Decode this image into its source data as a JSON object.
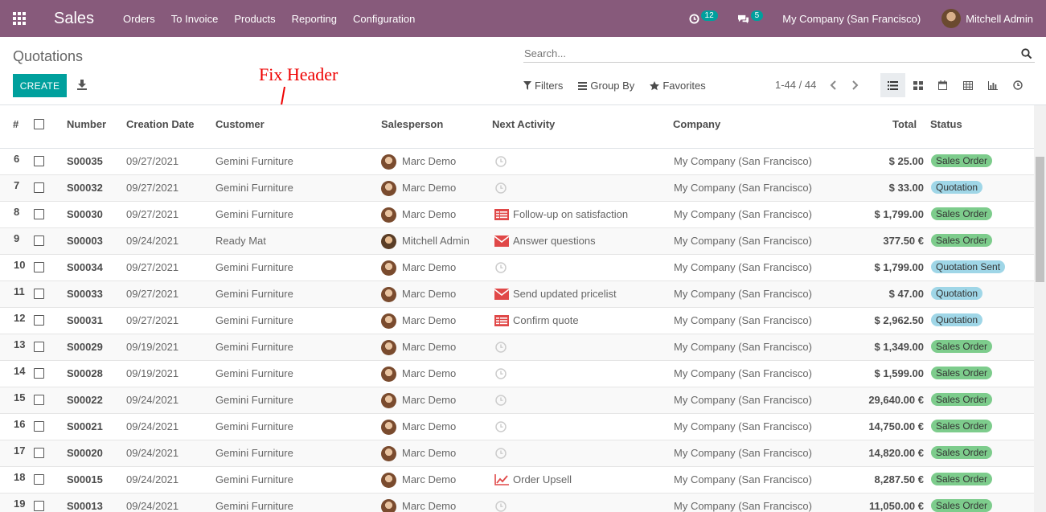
{
  "navbar": {
    "app_name": "Sales",
    "menu": [
      "Orders",
      "To Invoice",
      "Products",
      "Reporting",
      "Configuration"
    ],
    "activity_count": "12",
    "message_count": "5",
    "company": "My Company (San Francisco)",
    "user": "Mitchell Admin",
    "color": "#875a7b"
  },
  "control": {
    "title": "Quotations",
    "search_placeholder": "Search...",
    "create_label": "CREATE",
    "filters_label": "Filters",
    "groupby_label": "Group By",
    "favorites_label": "Favorites",
    "pager": "1-44 / 44",
    "accent": "#00a09d"
  },
  "annotation": "Fix Header",
  "columns": {
    "index": "#",
    "number": "Number",
    "date": "Creation Date",
    "customer": "Customer",
    "salesperson": "Salesperson",
    "activity": "Next Activity",
    "company": "Company",
    "total": "Total",
    "status": "Status"
  },
  "rows": [
    {
      "idx": "6",
      "number": "S00035",
      "date": "09/27/2021",
      "customer": "Gemini Furniture",
      "salesperson": "Marc Demo",
      "avatar": "marc",
      "activity_icon": "clock-icon",
      "activity": "",
      "company": "My Company (San Francisco)",
      "total": "$ 25.00",
      "status": "Sales Order",
      "status_kind": "so"
    },
    {
      "idx": "7",
      "number": "S00032",
      "date": "09/27/2021",
      "customer": "Gemini Furniture",
      "salesperson": "Marc Demo",
      "avatar": "marc",
      "activity_icon": "clock-icon",
      "activity": "",
      "company": "My Company (San Francisco)",
      "total": "$ 33.00",
      "status": "Quotation",
      "status_kind": "qt"
    },
    {
      "idx": "8",
      "number": "S00030",
      "date": "09/27/2021",
      "customer": "Gemini Furniture",
      "salesperson": "Marc Demo",
      "avatar": "marc",
      "activity_icon": "list-icon",
      "activity": "Follow-up on satisfaction",
      "company": "My Company (San Francisco)",
      "total": "$ 1,799.00",
      "status": "Sales Order",
      "status_kind": "so"
    },
    {
      "idx": "9",
      "number": "S00003",
      "date": "09/24/2021",
      "customer": "Ready Mat",
      "salesperson": "Mitchell Admin",
      "avatar": "mitchell",
      "activity_icon": "envelope-icon",
      "activity": "Answer questions",
      "company": "My Company (San Francisco)",
      "total": "377.50 €",
      "status": "Sales Order",
      "status_kind": "so"
    },
    {
      "idx": "10",
      "number": "S00034",
      "date": "09/27/2021",
      "customer": "Gemini Furniture",
      "salesperson": "Marc Demo",
      "avatar": "marc",
      "activity_icon": "clock-icon",
      "activity": "",
      "company": "My Company (San Francisco)",
      "total": "$ 1,799.00",
      "status": "Quotation Sent",
      "status_kind": "qt"
    },
    {
      "idx": "11",
      "number": "S00033",
      "date": "09/27/2021",
      "customer": "Gemini Furniture",
      "salesperson": "Marc Demo",
      "avatar": "marc",
      "activity_icon": "envelope-icon",
      "activity": "Send updated pricelist",
      "company": "My Company (San Francisco)",
      "total": "$ 47.00",
      "status": "Quotation",
      "status_kind": "qt"
    },
    {
      "idx": "12",
      "number": "S00031",
      "date": "09/27/2021",
      "customer": "Gemini Furniture",
      "salesperson": "Marc Demo",
      "avatar": "marc",
      "activity_icon": "list-icon",
      "activity": "Confirm quote",
      "company": "My Company (San Francisco)",
      "total": "$ 2,962.50",
      "status": "Quotation",
      "status_kind": "qt"
    },
    {
      "idx": "13",
      "number": "S00029",
      "date": "09/19/2021",
      "customer": "Gemini Furniture",
      "salesperson": "Marc Demo",
      "avatar": "marc",
      "activity_icon": "clock-icon",
      "activity": "",
      "company": "My Company (San Francisco)",
      "total": "$ 1,349.00",
      "status": "Sales Order",
      "status_kind": "so"
    },
    {
      "idx": "14",
      "number": "S00028",
      "date": "09/19/2021",
      "customer": "Gemini Furniture",
      "salesperson": "Marc Demo",
      "avatar": "marc",
      "activity_icon": "clock-icon",
      "activity": "",
      "company": "My Company (San Francisco)",
      "total": "$ 1,599.00",
      "status": "Sales Order",
      "status_kind": "so"
    },
    {
      "idx": "15",
      "number": "S00022",
      "date": "09/24/2021",
      "customer": "Gemini Furniture",
      "salesperson": "Marc Demo",
      "avatar": "marc",
      "activity_icon": "clock-icon",
      "activity": "",
      "company": "My Company (San Francisco)",
      "total": "29,640.00 €",
      "status": "Sales Order",
      "status_kind": "so"
    },
    {
      "idx": "16",
      "number": "S00021",
      "date": "09/24/2021",
      "customer": "Gemini Furniture",
      "salesperson": "Marc Demo",
      "avatar": "marc",
      "activity_icon": "clock-icon",
      "activity": "",
      "company": "My Company (San Francisco)",
      "total": "14,750.00 €",
      "status": "Sales Order",
      "status_kind": "so"
    },
    {
      "idx": "17",
      "number": "S00020",
      "date": "09/24/2021",
      "customer": "Gemini Furniture",
      "salesperson": "Marc Demo",
      "avatar": "marc",
      "activity_icon": "clock-icon",
      "activity": "",
      "company": "My Company (San Francisco)",
      "total": "14,820.00 €",
      "status": "Sales Order",
      "status_kind": "so"
    },
    {
      "idx": "18",
      "number": "S00015",
      "date": "09/24/2021",
      "customer": "Gemini Furniture",
      "salesperson": "Marc Demo",
      "avatar": "marc",
      "activity_icon": "chart-line-icon",
      "activity": "Order Upsell",
      "company": "My Company (San Francisco)",
      "total": "8,287.50 €",
      "status": "Sales Order",
      "status_kind": "so"
    },
    {
      "idx": "19",
      "number": "S00013",
      "date": "09/24/2021",
      "customer": "Gemini Furniture",
      "salesperson": "Marc Demo",
      "avatar": "marc",
      "activity_icon": "clock-icon",
      "activity": "",
      "company": "My Company (San Francisco)",
      "total": "11,050.00 €",
      "status": "Sales Order",
      "status_kind": "so"
    }
  ]
}
